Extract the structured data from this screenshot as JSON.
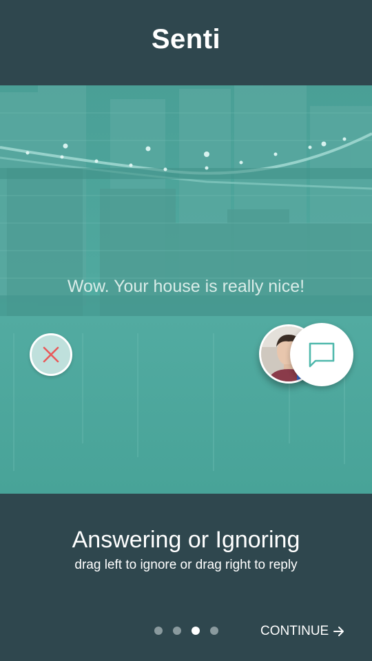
{
  "header": {
    "title": "Senti"
  },
  "card": {
    "message": "Wow. Your house is really nice!"
  },
  "icons": {
    "ignore": "close-icon",
    "reply": "chat-bubble-icon",
    "continue": "arrow-right-icon"
  },
  "onboarding": {
    "title": "Answering or Ignoring",
    "subtitle": "drag left to ignore or drag right to reply",
    "pages": [
      {
        "active": false
      },
      {
        "active": false
      },
      {
        "active": true
      },
      {
        "active": false
      }
    ],
    "continue_label": "CONTINUE"
  },
  "colors": {
    "background": "#2f474e",
    "accent": "#4fb8ac",
    "ignore": "#e85a5a"
  }
}
